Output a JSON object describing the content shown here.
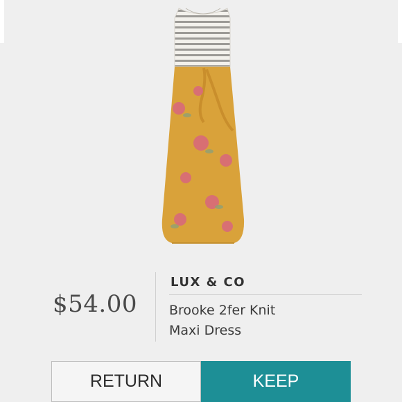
{
  "product": {
    "brand": "LUX & CO",
    "name_line1": "Brooke 2fer Knit",
    "name_line2": "Maxi Dress",
    "price": "$54.00"
  },
  "actions": {
    "return_label": "RETURN",
    "keep_label": "KEEP"
  },
  "colors": {
    "background": "#efefef",
    "keep_button": "#1d8f96",
    "dress_skirt": "#d9a23a",
    "dress_bodice_stripe": "#9a9a9a"
  }
}
